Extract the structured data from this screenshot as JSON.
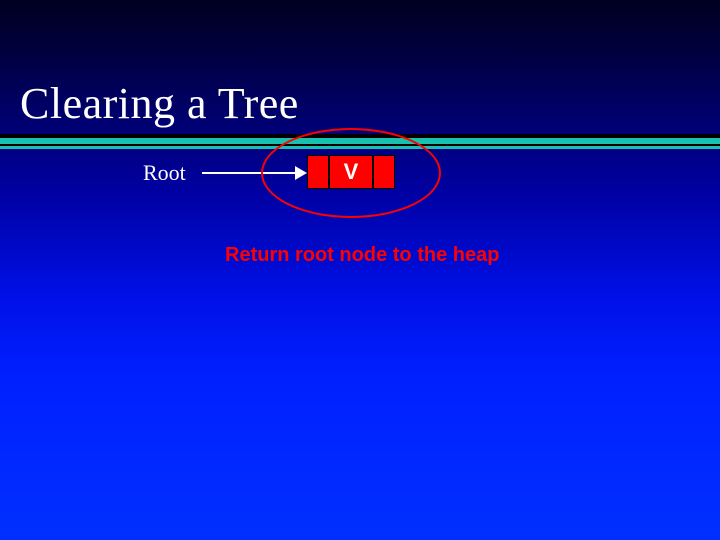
{
  "slide": {
    "title": "Clearing a Tree",
    "root_label": "Root",
    "node_value": "V",
    "caption": "Return root node to the heap"
  }
}
